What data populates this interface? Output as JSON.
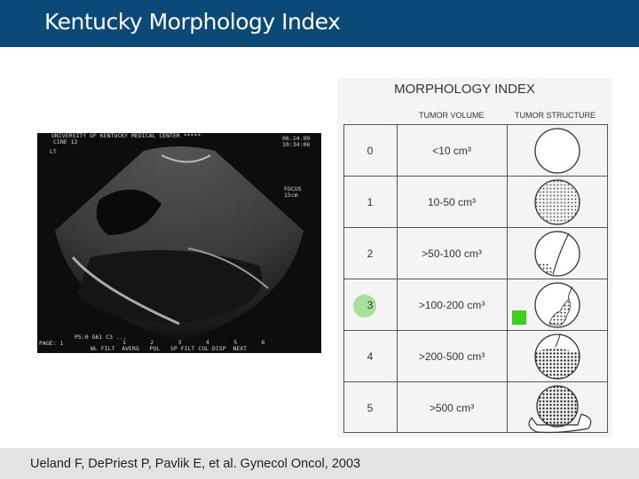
{
  "slide": {
    "title": "Kentucky Morphology Index",
    "citation": "Ueland F, DePriest P, Pavlik E, et al. Gynecol Oncol, 2003"
  },
  "ultrasound": {
    "header": "UNIVERSITY OF KENTUCKY MEDICAL CENTER *****",
    "cine": "CINE 12",
    "lt": "LT",
    "date": "06.14.99",
    "time": "10:34:06",
    "focus": "FOCUS",
    "focus_val": "15cm",
    "page": "PAGE: 1",
    "ps": "PS:0 G61 C3 ...",
    "nums": "1       2       3       4       5       6",
    "controls": "WL FILT  AVERG   POL   SP FILT COL DISP  NEXT"
  },
  "table": {
    "title": "MORPHOLOGY INDEX",
    "col_volume": "TUMOR VOLUME",
    "col_structure": "TUMOR STRUCTURE",
    "rows": [
      {
        "index": "0",
        "volume": "<10 cm³",
        "structure": "empty-circle"
      },
      {
        "index": "1",
        "volume": "10-50 cm³",
        "structure": "stippled-circle"
      },
      {
        "index": "2",
        "volume": ">50-100 cm³",
        "structure": "septated-circle"
      },
      {
        "index": "3",
        "volume": ">100-200 cm³",
        "structure": "papillary-projection-circle"
      },
      {
        "index": "4",
        "volume": ">200-500 cm³",
        "structure": "mostly-solid-circle"
      },
      {
        "index": "5",
        "volume": ">500 cm³",
        "structure": "solid-with-extension-circle"
      }
    ],
    "highlight_color": "#a8e29a",
    "marker_color": "#3ccf1e"
  },
  "colors": {
    "title_bar": "#0b4a78",
    "citation_bar": "#e3e3e3"
  }
}
